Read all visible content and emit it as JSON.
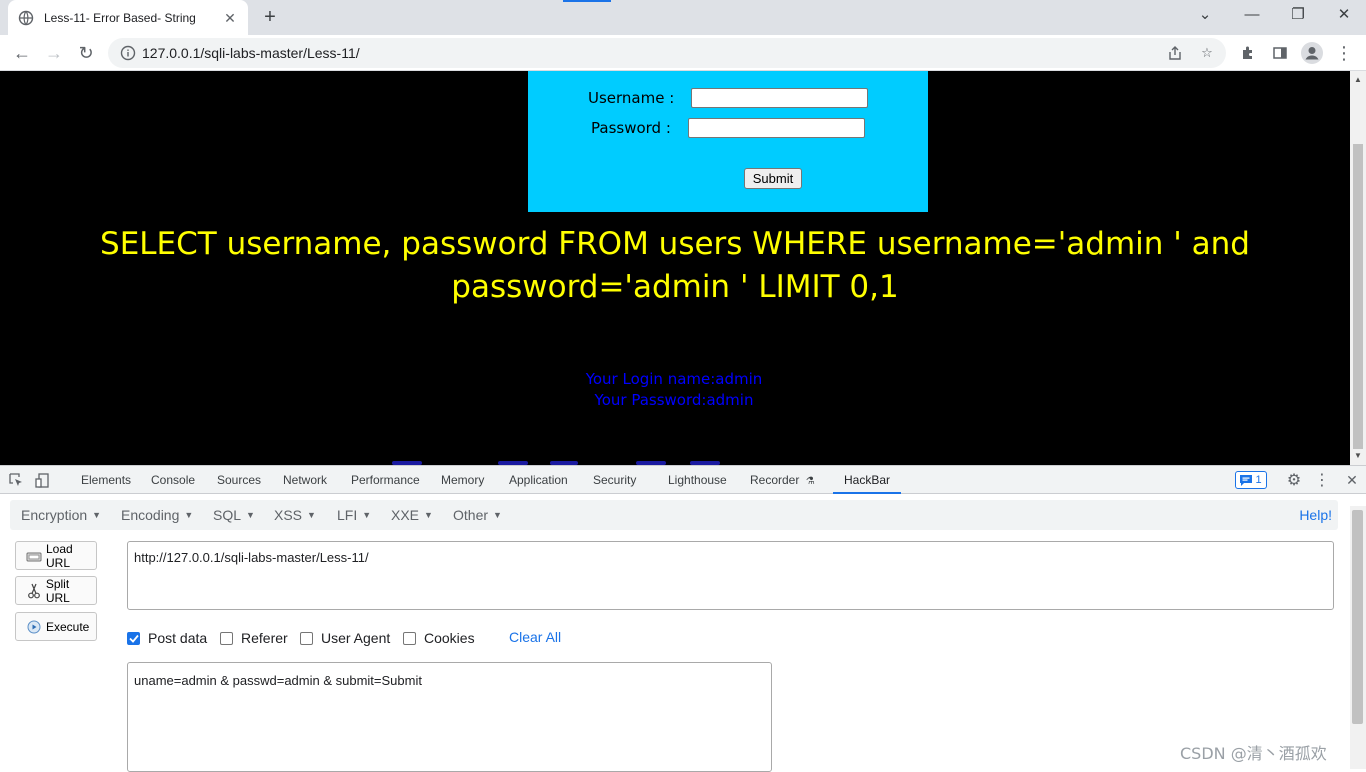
{
  "browser": {
    "tab_title": "Less-11- Error Based- String",
    "url": "127.0.0.1/sqli-labs-master/Less-11/"
  },
  "page": {
    "username_label": "Username :",
    "password_label": "Password :",
    "submit_label": "Submit",
    "query_line1": "SELECT username, password FROM users WHERE username='admin ' and",
    "query_line2": "password='admin ' LIMIT 0,1",
    "login_name": "Your Login name:admin",
    "login_password": "Your Password:admin"
  },
  "devtools": {
    "tabs": [
      "Elements",
      "Console",
      "Sources",
      "Network",
      "Performance",
      "Memory",
      "Application",
      "Security",
      "Lighthouse",
      "Recorder",
      "HackBar"
    ],
    "active_tab": "HackBar",
    "issues_count": "1"
  },
  "hackbar": {
    "menu": [
      "Encryption",
      "Encoding",
      "SQL",
      "XSS",
      "LFI",
      "XXE",
      "Other"
    ],
    "help": "Help!",
    "buttons": {
      "load": "Load URL",
      "split": "Split URL",
      "execute": "Execute"
    },
    "url_value": "http://127.0.0.1/sqli-labs-master/Less-11/",
    "options": [
      {
        "label": "Post data",
        "checked": true
      },
      {
        "label": "Referer",
        "checked": false
      },
      {
        "label": "User Agent",
        "checked": false
      },
      {
        "label": "Cookies",
        "checked": false
      }
    ],
    "clear_all": "Clear All",
    "post_value": "uname=admin & passwd=admin & submit=Submit"
  },
  "watermark": "CSDN @清丶酒孤欢",
  "colors": {
    "page_bg": "#000000",
    "login_box": "#00ccff",
    "query_text": "#ffff00",
    "result_text": "#0000ff",
    "accent": "#1a73e8"
  }
}
